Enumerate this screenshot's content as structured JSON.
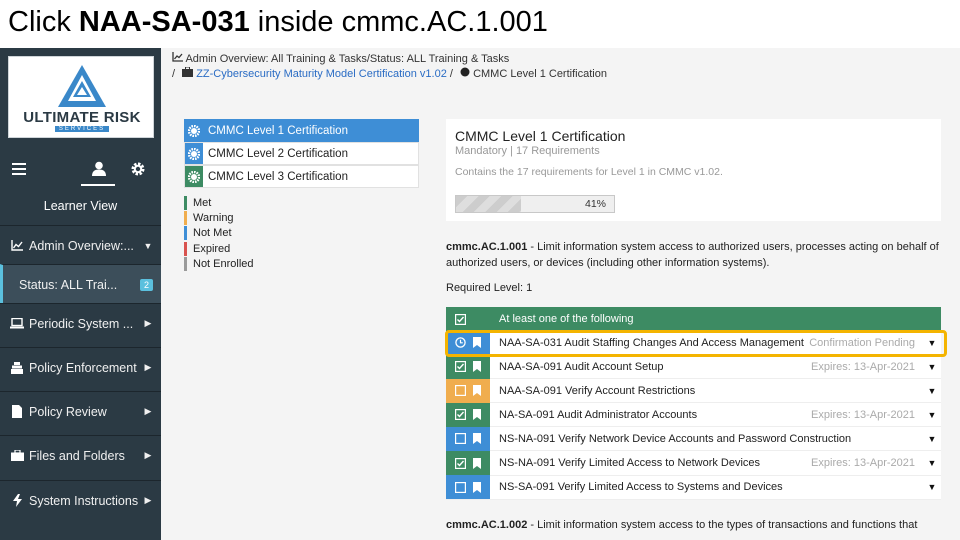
{
  "banner": {
    "prefix": "Click ",
    "target": "NAA-SA-031",
    "suffix": " inside cmmc.AC.1.001"
  },
  "logo": {
    "main": "ULTIMATE RISK",
    "sub": "SERVICES"
  },
  "sidebar": {
    "learner_label": "Learner View",
    "items": [
      {
        "label": "Admin Overview:...",
        "icon": "chart-icon"
      },
      {
        "label": "Status: ALL Trai...",
        "badge": "2"
      },
      {
        "label": "Periodic System ...",
        "icon": "laptop-icon"
      },
      {
        "label": "Policy Enforcement",
        "icon": "gavel-icon"
      },
      {
        "label": "Policy Review",
        "icon": "file-icon"
      },
      {
        "label": "Files and Folders",
        "icon": "briefcase-icon"
      },
      {
        "label": "System Instructions",
        "icon": "bolt-icon"
      }
    ]
  },
  "breadcrumb": {
    "line1": "Admin Overview: All Training & Tasks/Status: ALL Training & Tasks",
    "sep": "/",
    "link": "ZZ-Cybersecurity Maturity Model Certification v1.02",
    "current": "CMMC Level 1 Certification"
  },
  "levels": [
    {
      "label": "CMMC Level 1 Certification"
    },
    {
      "label": "CMMC Level 2 Certification"
    },
    {
      "label": "CMMC Level 3 Certification"
    }
  ],
  "legend": [
    {
      "label": "Met",
      "color": "#3d8b63"
    },
    {
      "label": "Warning",
      "color": "#f0ad4e"
    },
    {
      "label": "Not Met",
      "color": "#3e8ed6"
    },
    {
      "label": "Expired",
      "color": "#d9534f"
    },
    {
      "label": "Not Enrolled",
      "color": "#9a9a9a"
    }
  ],
  "card": {
    "title": "CMMC Level 1 Certification",
    "subtitle": "Mandatory | 17 Requirements",
    "description": "Contains the 17 requirements  for Level 1 in CMMC v1.02.",
    "progress_text": "41%",
    "progress_value": 0.41
  },
  "requirement": {
    "id": "cmmc.AC.1.001",
    "text": " - Limit information system access to authorized users, processes acting on behalf of authorized users, or devices (including other information systems).",
    "required_level": "Required Level: 1",
    "group_label": "At least one of the following",
    "rows": [
      {
        "name": "NAA-SA-031 Audit Staffing Changes And Access Management",
        "status": "Confirmation Pending",
        "state": "pending"
      },
      {
        "name": "NAA-SA-091 Audit Account Setup",
        "status": "Expires: 13-Apr-2021",
        "state": "met"
      },
      {
        "name": "NAA-SA-091 Verify Account Restrictions",
        "status": "",
        "state": "warning"
      },
      {
        "name": "NA-SA-091 Audit Administrator Accounts",
        "status": "Expires: 13-Apr-2021",
        "state": "met"
      },
      {
        "name": "NS-NA-091 Verify Network Device Accounts and Password Construction",
        "status": "",
        "state": "notmet"
      },
      {
        "name": "NS-NA-091 Verify Limited Access to Network Devices",
        "status": "Expires: 13-Apr-2021",
        "state": "met"
      },
      {
        "name": "NS-SA-091 Verify Limited Access to Systems and Devices",
        "status": "",
        "state": "notmet"
      }
    ]
  },
  "requirement2": {
    "id": "cmmc.AC.1.002",
    "text": " - Limit information system access to the types of transactions and functions that"
  },
  "colors": {
    "met": "#3d8b63",
    "warning": "#f0ad4e",
    "notmet": "#3e8ed6",
    "highlight": "#f4b400",
    "sidebar": "#2b3a44"
  }
}
